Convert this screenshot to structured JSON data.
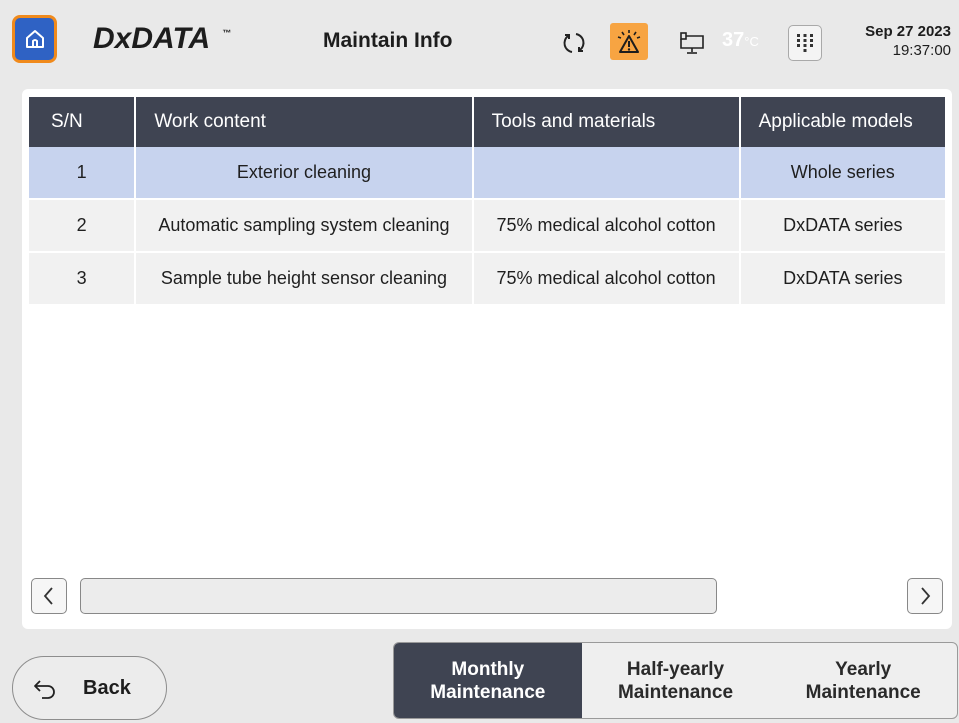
{
  "header": {
    "logo": "DxDATA",
    "logo_tm": "™",
    "title": "Maintain Info",
    "temperature": "37",
    "temperature_unit": "°C",
    "date": "Sep 27 2023",
    "time": "19:37:00",
    "icons": [
      "home-icon",
      "sync-icon",
      "alarm-warning-icon",
      "computer-icon",
      "keypad-icon"
    ],
    "colors": {
      "home_bg": "#2f62c4",
      "home_border": "#f08a1c",
      "alarm_bg": "#f7a442"
    }
  },
  "table": {
    "columns": [
      "S/N",
      "Work content",
      "Tools and materials",
      "Applicable models"
    ],
    "rows": [
      {
        "sn": "1",
        "work": "Exterior cleaning",
        "tools": "",
        "models": "Whole series"
      },
      {
        "sn": "2",
        "work": "Automatic sampling system cleaning",
        "tools": "75% medical alcohol cotton",
        "models": "DxDATA series"
      },
      {
        "sn": "3",
        "work": "Sample tube height sensor cleaning",
        "tools": "75% medical alcohol cotton",
        "models": "DxDATA series"
      }
    ],
    "selected_row": 1,
    "colors": {
      "header_bg": "#3f4452",
      "row_bg": "#f1f1f1",
      "selected_bg": "#c7d3ee"
    }
  },
  "scroll": {
    "left_icon": "chevron-left-icon",
    "right_icon": "chevron-right-icon"
  },
  "footer": {
    "back_label": "Back",
    "tabs": [
      {
        "line1": "Monthly",
        "line2": "Maintenance",
        "active": true
      },
      {
        "line1": "Half-yearly",
        "line2": "Maintenance",
        "active": false
      },
      {
        "line1": "Yearly",
        "line2": "Maintenance",
        "active": false
      }
    ]
  }
}
